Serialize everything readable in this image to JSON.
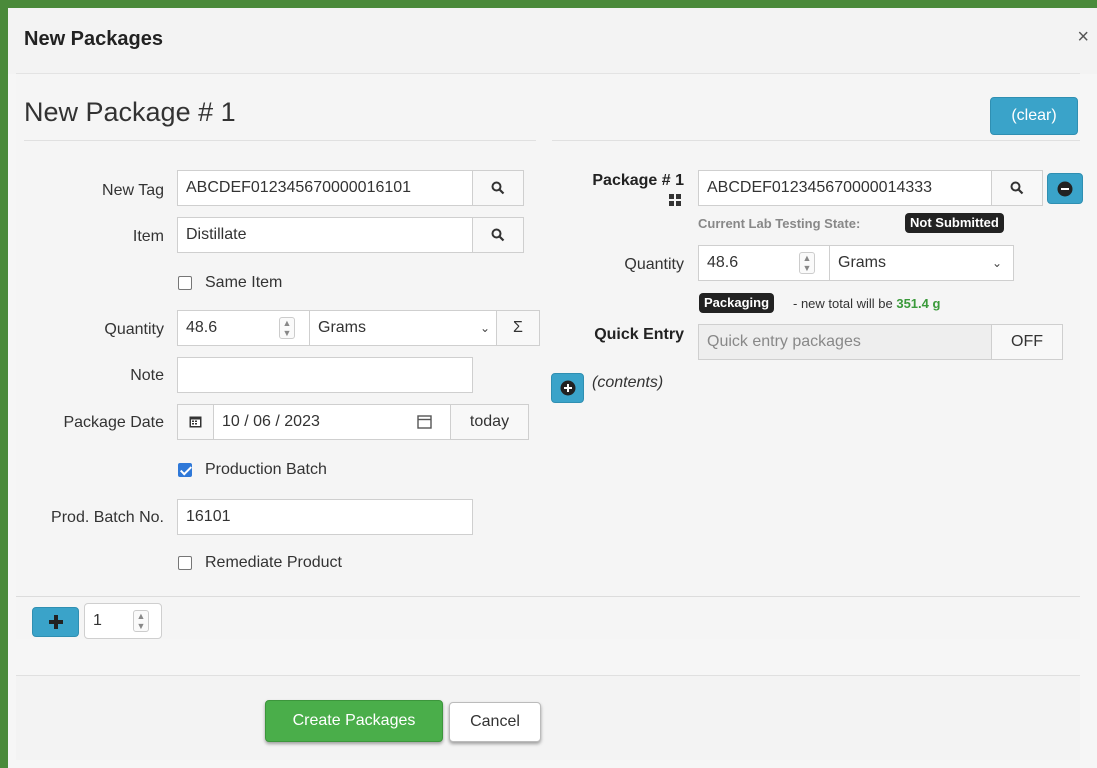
{
  "modal": {
    "title": "New Packages",
    "close_label": "×"
  },
  "page": {
    "title": "New Package # 1",
    "clear_label": "(clear)"
  },
  "left": {
    "new_tag": {
      "label": "New Tag",
      "value": "ABCDEF012345670000016101"
    },
    "item": {
      "label": "Item",
      "value": "Distillate"
    },
    "same_item": {
      "label": "Same Item",
      "checked": false
    },
    "quantity": {
      "label": "Quantity",
      "value": "48.6",
      "unit": "Grams",
      "sum_label": "Σ"
    },
    "note": {
      "label": "Note",
      "value": ""
    },
    "package_date": {
      "label": "Package Date",
      "value": "10 / 06 / 2023",
      "today_label": "today"
    },
    "production_batch": {
      "label": "Production Batch",
      "checked": true
    },
    "prod_batch_no": {
      "label": "Prod. Batch No.",
      "value": "16101"
    },
    "remediate": {
      "label": "Remediate Product",
      "checked": false
    }
  },
  "right": {
    "package": {
      "label": "Package # 1",
      "value": "ABCDEF012345670000014333"
    },
    "lab_state": {
      "label": "Current Lab Testing State:",
      "value": "Not Submitted"
    },
    "quantity": {
      "label": "Quantity",
      "value": "48.6",
      "unit": "Grams"
    },
    "packaging": {
      "badge": "Packaging",
      "text": "- new total will be",
      "total": "351.4 g"
    },
    "quick_entry": {
      "label": "Quick Entry",
      "placeholder": "Quick entry packages",
      "toggle": "OFF"
    },
    "contents_label": "(contents)"
  },
  "footer": {
    "add_count": "1",
    "create_label": "Create Packages",
    "cancel_label": "Cancel"
  },
  "colors": {
    "accent_info": "#3aa3c9",
    "success": "#4aae4a",
    "frame": "#4a8a3a"
  },
  "icons": [
    "search-icon",
    "minus-circle-icon",
    "plus-circle-icon",
    "plus-icon",
    "calendar-icon",
    "barcode-icon",
    "close-icon"
  ]
}
